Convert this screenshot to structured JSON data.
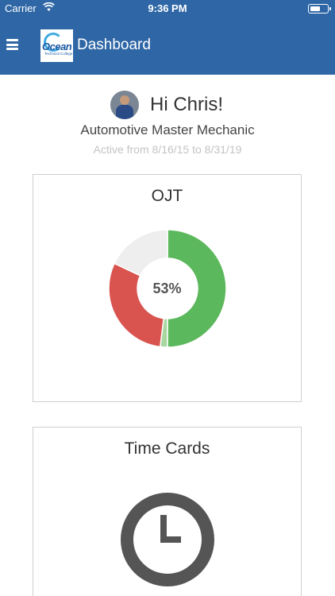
{
  "status_bar": {
    "carrier": "Carrier",
    "time": "9:36 PM",
    "icons": [
      "wifi-icon",
      "battery-icon"
    ]
  },
  "nav": {
    "menu_icon": "hamburger-menu-icon",
    "logo_text": "Ocean",
    "logo_subtext": "Technical College",
    "title": "Dashboard",
    "bar_color": "#2f67a6"
  },
  "profile": {
    "greeting": "Hi Chris!",
    "role": "Automotive Master Mechanic",
    "active_range": "Active from 8/16/15 to 8/31/19"
  },
  "ojt_card": {
    "title": "OJT",
    "percent_label": "53%",
    "segments": [
      {
        "value": 0.5,
        "color": "#5cb85c"
      },
      {
        "value": 0.02,
        "color": "#a8d8a0"
      },
      {
        "value": 0.3,
        "color": "#d9534f"
      },
      {
        "value": 0.18,
        "color": "#eeeeee"
      }
    ]
  },
  "time_cards": {
    "title": "Time Cards",
    "icon": "clock-icon"
  }
}
